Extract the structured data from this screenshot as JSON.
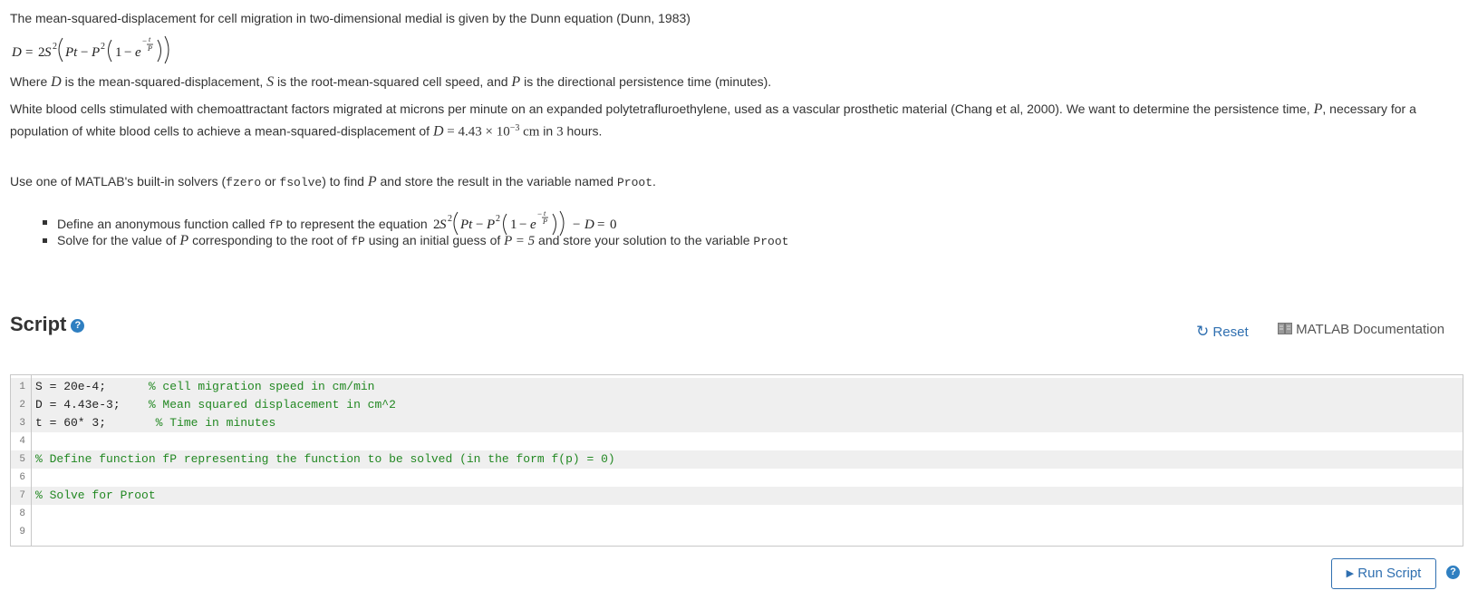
{
  "intro": "The mean-squared-displacement for cell migration in two-dimensional medial is given by the Dunn equation (Dunn, 1983)",
  "where": {
    "p1": "Where ",
    "p2": " is the mean-squared-displacement, ",
    "p3": " is the root-mean-squared cell speed, and ",
    "p4": " is the directional persistence time (minutes)."
  },
  "problem": {
    "line1": "White blood cells stimulated with chemoattractant factors migrated at  microns per minute on an expanded polytetrafluroethylene, used as a vascular prosthetic material (Chang et al, 2000). We want to determine the persistence time, ",
    "line1b": ", necessary for a",
    "line2a": "population of white blood cells to achieve a mean-squared-displacement of ",
    "line2b": " in ",
    "line2c": " hours.",
    "d_value": "4.43 × 10",
    "d_exp": "−3",
    "d_unit": "cm",
    "hours": "3"
  },
  "instructions": {
    "use": "Use one of MATLAB's built-in solvers (",
    "fzero": "fzero",
    "or": " or ",
    "fsolve": "fsolve",
    "to_find": ") to find ",
    "store": " and store the result in the variable named ",
    "proot": "Proot",
    "period": ".",
    "bullet1a": "Define an anonymous function called ",
    "fp": "fP",
    "bullet1b": " to represent the equation ",
    "bullet2a": "Solve for the value of ",
    "bullet2b": " corresponding to the root of ",
    "bullet2c": " using an initial guess of ",
    "guess": "P = 5",
    "bullet2d": " and store your solution to the variable "
  },
  "script": {
    "title": "Script",
    "help": "?",
    "reset_label": "Reset",
    "doc_label": "MATLAB Documentation",
    "run_label": "Run Script"
  },
  "code_lines": [
    {
      "n": "1",
      "code": "S = 20e-4;      ",
      "comment": "% cell migration speed in cm/min"
    },
    {
      "n": "2",
      "code": "D = 4.43e-3;    ",
      "comment": "% Mean squared displacement in cm^2"
    },
    {
      "n": "3",
      "code": "t = 60* 3;       ",
      "comment": "% Time in minutes"
    },
    {
      "n": "4",
      "code": "",
      "comment": ""
    },
    {
      "n": "5",
      "code": "",
      "comment": "% Define function fP representing the function to be solved (in the form f(p) = 0)"
    },
    {
      "n": "6",
      "code": "",
      "comment": ""
    },
    {
      "n": "7",
      "code": "",
      "comment": "% Solve for Proot"
    },
    {
      "n": "8",
      "code": "",
      "comment": ""
    },
    {
      "n": "9",
      "code": "",
      "comment": ""
    }
  ],
  "colors": {
    "accent": "#2f6fb0",
    "comment": "#228822",
    "highlight": "#efefef"
  }
}
